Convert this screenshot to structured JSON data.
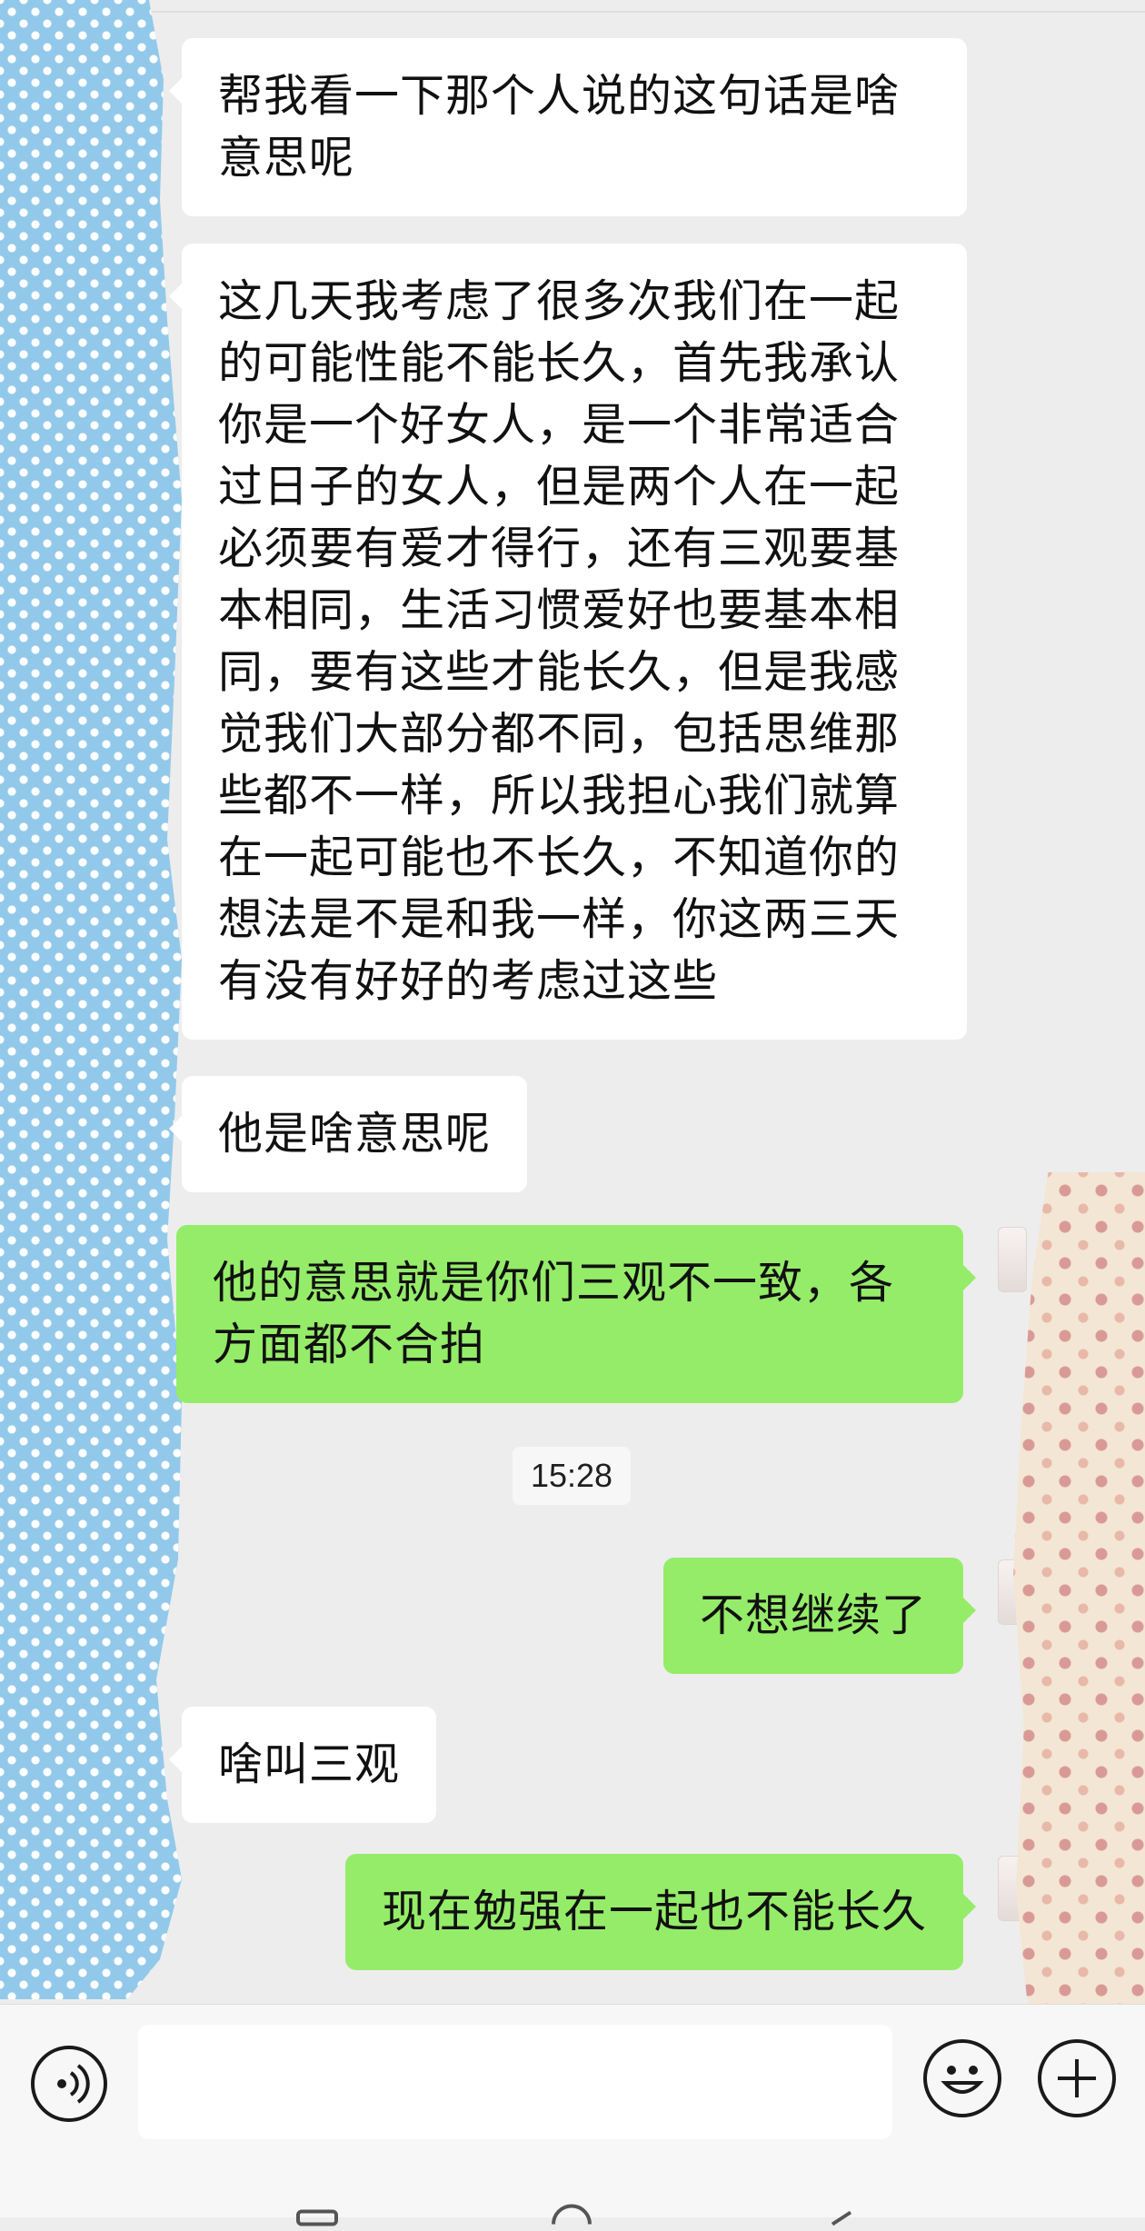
{
  "messages": [
    {
      "side": "in",
      "text": "帮我看一下那个人说的这句话是啥意思呢"
    },
    {
      "side": "in",
      "text": "这几天我考虑了很多次我们在一起的可能性能不能长久，首先我承认你是一个好女人，是一个非常适合过日子的女人，但是两个人在一起必须要有爱才得行，还有三观要基本相同，生活习惯爱好也要基本相同，要有这些才能长久，但是我感觉我们大部分都不同，包括思维那些都不一样，所以我担心我们就算在一起可能也不长久，不知道你的想法是不是和我一样，你这两三天有没有好好的考虑过这些"
    },
    {
      "side": "in",
      "text": "他是啥意思呢"
    },
    {
      "side": "out",
      "text": "他的意思就是你们三观不一致，各方面都不合拍"
    },
    {
      "side": "out",
      "text": "不想继续了"
    },
    {
      "side": "in",
      "text": "啥叫三观"
    },
    {
      "side": "out",
      "text": "现在勉强在一起也不能长久"
    }
  ],
  "timestamp": "15:28",
  "input": {
    "value": "",
    "placeholder": ""
  },
  "icons": {
    "voice": "voice-icon",
    "emoji": "emoji-icon",
    "plus": "plus-icon",
    "nav_home": "home-icon",
    "nav_back": "back-icon"
  },
  "colors": {
    "background": "#ededed",
    "incoming_bubble": "#ffffff",
    "outgoing_bubble": "#95ec69",
    "left_mask": "#92c9ea",
    "right_mask": "#f3e6d4"
  }
}
